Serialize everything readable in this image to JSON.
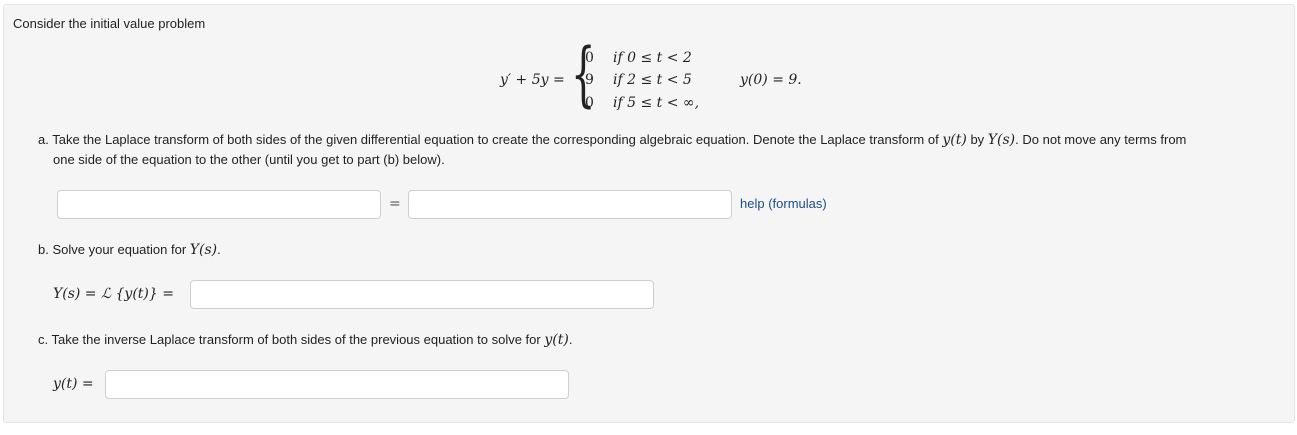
{
  "intro": "Consider the initial value problem",
  "equation": {
    "lhs": "y′ + 5y =",
    "cases": [
      {
        "value": "0",
        "condition": "if 0 ≤ t < 2"
      },
      {
        "value": "9",
        "condition": "if 2 ≤ t < 5"
      },
      {
        "value": "0",
        "condition": "if 5 ≤ t < ∞,"
      }
    ],
    "initial_condition": "y(0) = 9."
  },
  "part_a": {
    "line1_prefix": "a. Take the Laplace transform of both sides of the given differential equation to create the corresponding algebraic equation. Denote the Laplace transform of",
    "yt": "y(t)",
    "by": "by",
    "Ys": "Y(s)",
    "line1_suffix": ". Do not move any terms from",
    "line2": "one side of the equation to the other (until you get to part (b) below).",
    "left_value": "",
    "equals": "=",
    "right_value": "",
    "help_link": "help (formulas)"
  },
  "part_b": {
    "text": "b. Solve your equation for",
    "Ys": "Y(s)",
    "period": ".",
    "label": "Y(s) = ℒ {y(t)} =",
    "value": ""
  },
  "part_c": {
    "text": "c. Take the inverse Laplace transform of both sides of the previous equation to solve for",
    "yt": "y(t)",
    "period": ".",
    "label": "y(t) =",
    "value": ""
  }
}
